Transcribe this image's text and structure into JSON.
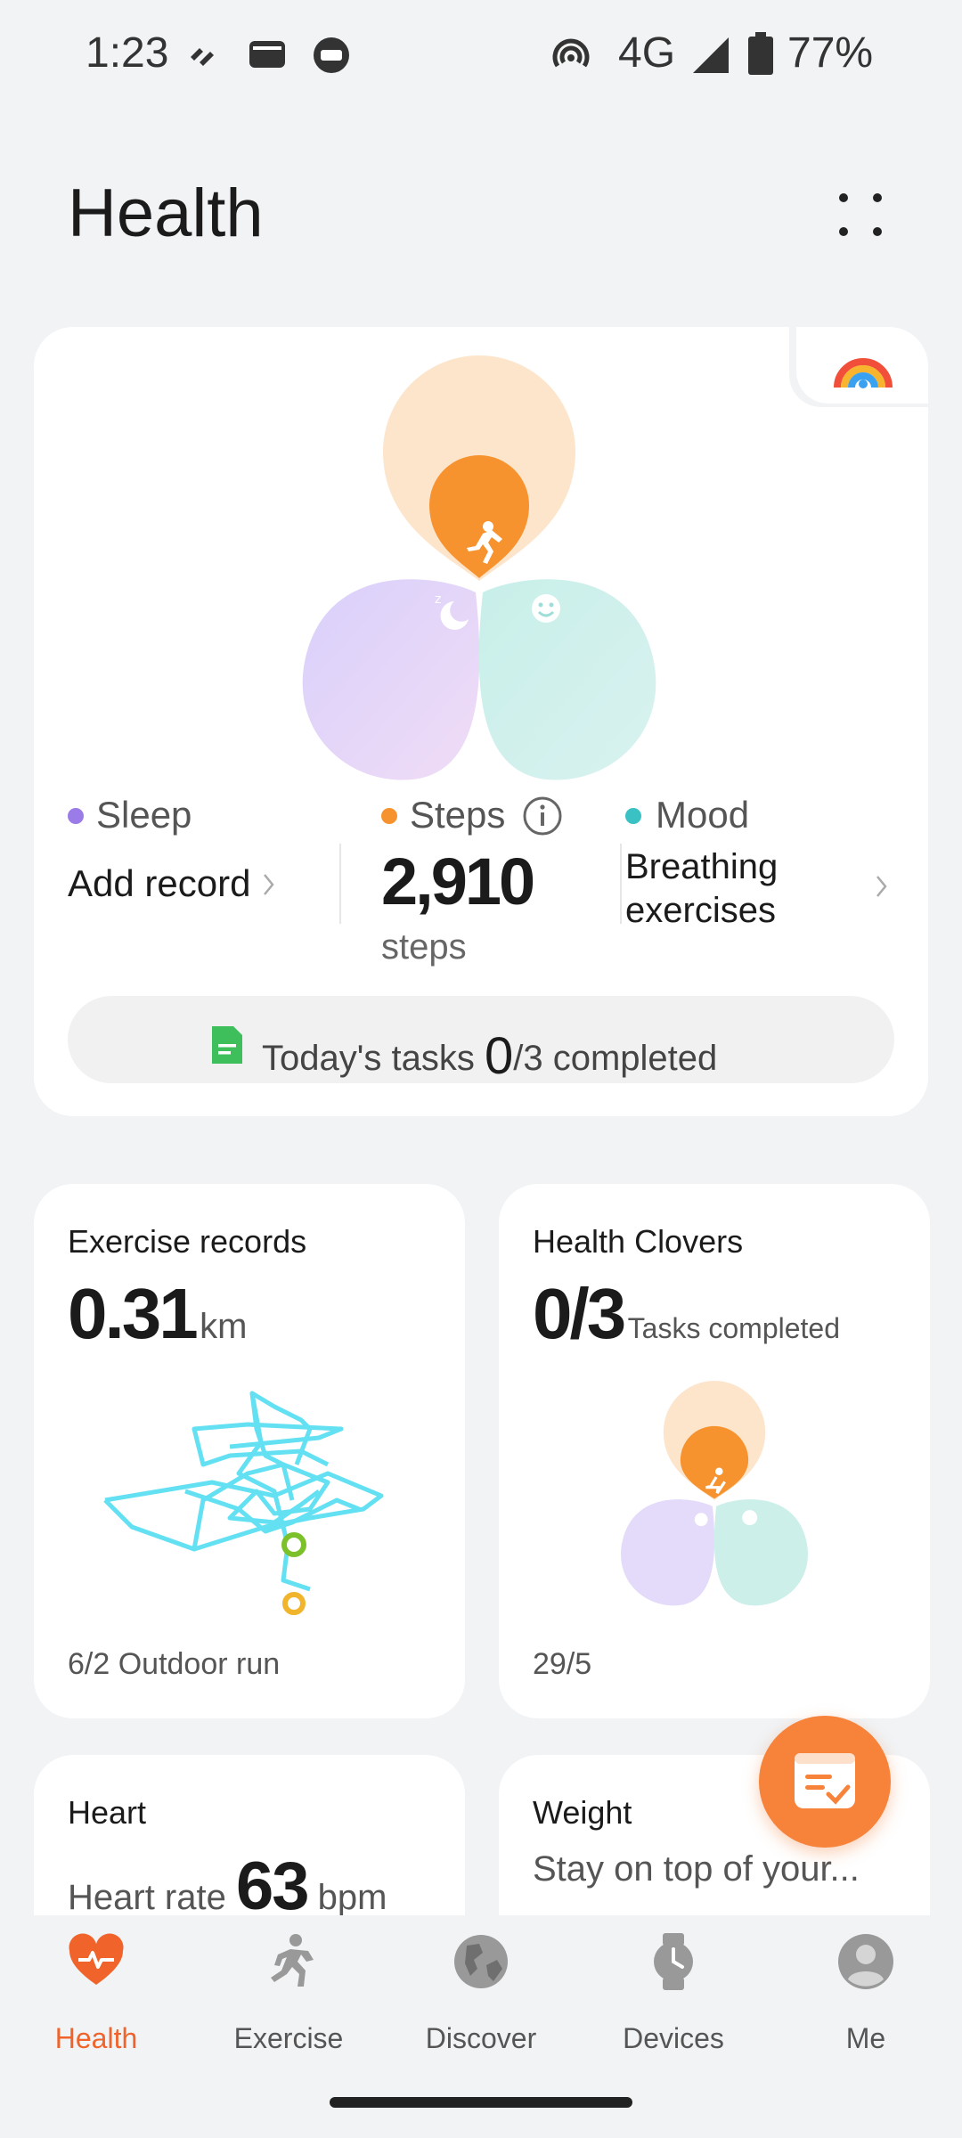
{
  "status_bar": {
    "time": "1:23",
    "network": "4G",
    "battery": "77%"
  },
  "header": {
    "title": "Health"
  },
  "summary": {
    "sleep": {
      "label": "Sleep",
      "value": "Add record",
      "color": "#9b7be8"
    },
    "steps": {
      "label": "Steps",
      "value": "2,910",
      "unit": "steps",
      "color": "#f7932e"
    },
    "mood": {
      "label": "Mood",
      "value_line1": "Breathing",
      "value_line2": "exercises",
      "color": "#39c1c4"
    },
    "tasks": {
      "prefix": "Today's tasks",
      "done": "0",
      "suffix": "/3 completed"
    }
  },
  "exercise_card": {
    "title": "Exercise records",
    "value": "0.31",
    "unit": "km",
    "date": "6/2",
    "activity": "Outdoor run"
  },
  "clovers_card": {
    "title": "Health Clovers",
    "value": "0/3",
    "unit": "Tasks completed",
    "date": "29/5"
  },
  "heart_card": {
    "title": "Heart",
    "prefix": "Heart rate",
    "value": "63",
    "unit": "bpm"
  },
  "weight_card": {
    "title": "Weight",
    "subtitle": "Stay on top of your..."
  },
  "nav": {
    "active_color": "#f0642c",
    "items": [
      {
        "label": "Health",
        "icon": "heart-pulse-icon"
      },
      {
        "label": "Exercise",
        "icon": "running-icon"
      },
      {
        "label": "Discover",
        "icon": "globe-icon"
      },
      {
        "label": "Devices",
        "icon": "watch-icon"
      },
      {
        "label": "Me",
        "icon": "person-icon"
      }
    ]
  }
}
